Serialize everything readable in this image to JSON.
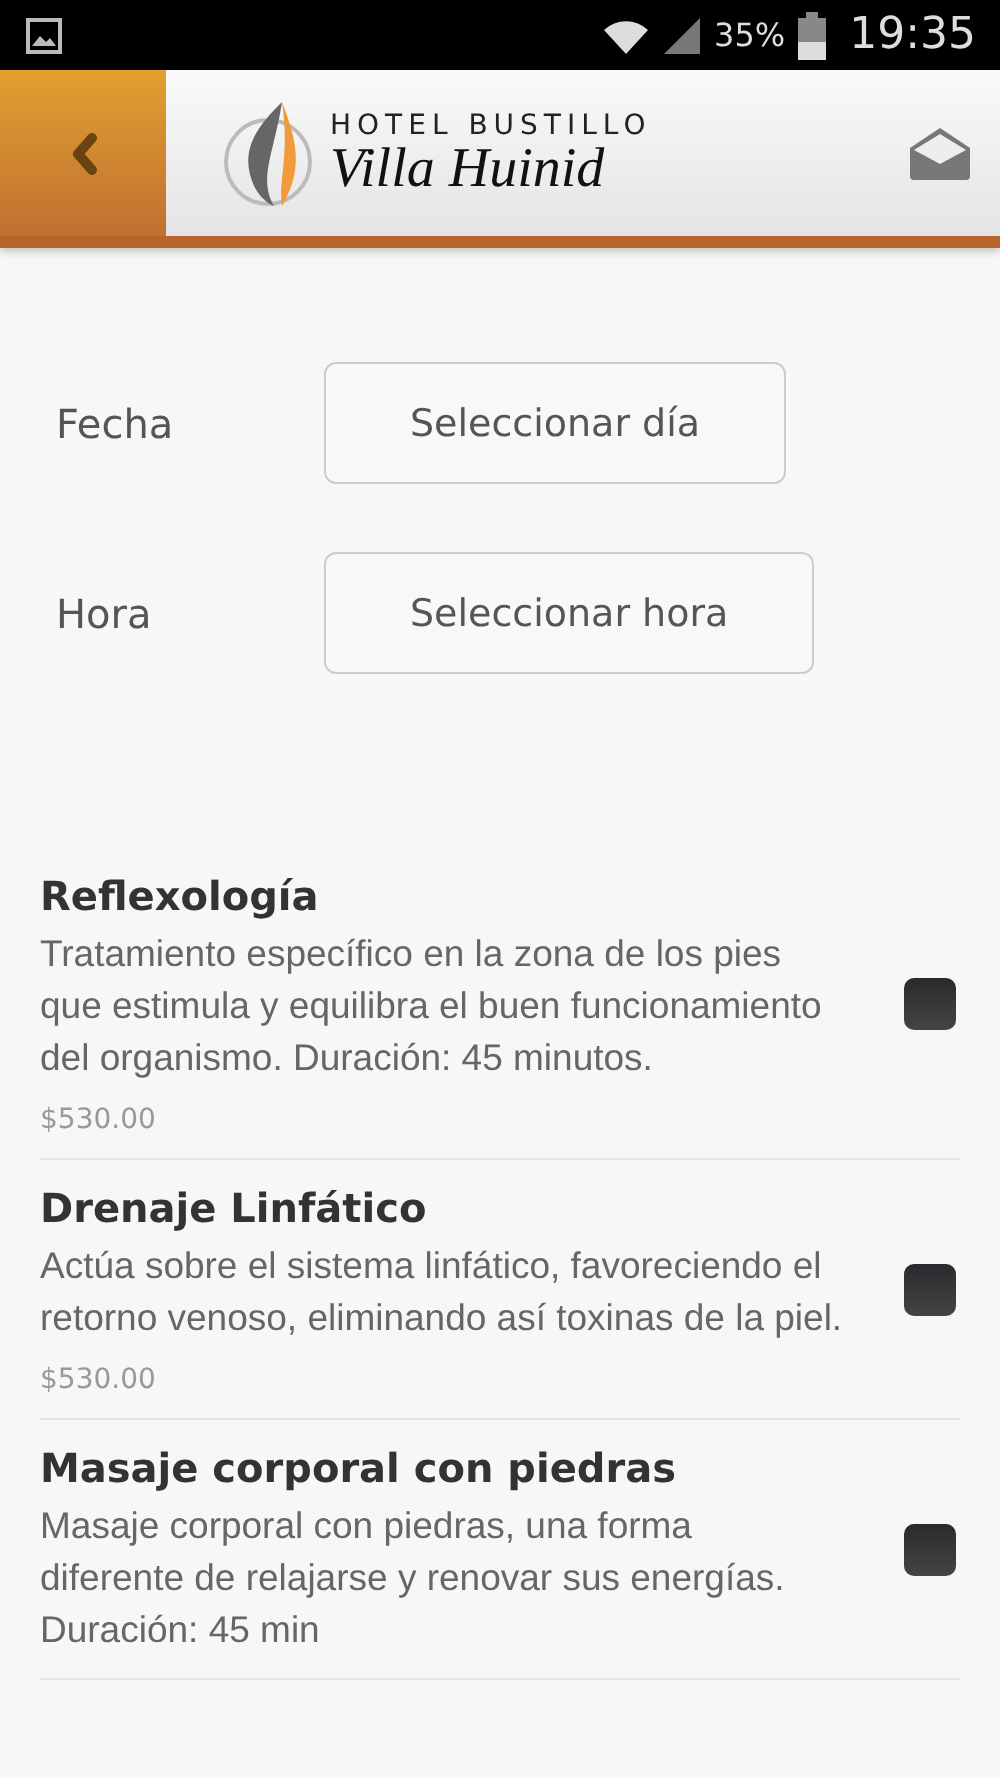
{
  "status_bar": {
    "battery": "35%",
    "time": "19:35"
  },
  "header": {
    "logo_line1": "HOTEL BUSTILLO",
    "logo_line2": "Villa Huinid"
  },
  "form": [
    {
      "label": "Fecha",
      "button": "Seleccionar día"
    },
    {
      "label": "Hora",
      "button": "Seleccionar hora"
    }
  ],
  "services": [
    {
      "name": "Reflexología",
      "description": "Tratamiento específico en la zona de los pies que estimula y equilibra el buen funcionamiento del organismo. Duración: 45 minutos.",
      "price": "$530.00",
      "checked": false
    },
    {
      "name": "Drenaje Linfático",
      "description": "Actúa sobre el sistema linfático, favoreciendo el retorno venoso, eliminando así toxinas de la piel.",
      "price": "$530.00",
      "checked": false
    },
    {
      "name": "Masaje corporal con piedras",
      "description": "Masaje corporal con piedras, una forma diferente de relajarse y renovar sus energías. Duración: 45 min",
      "checked": false
    }
  ]
}
